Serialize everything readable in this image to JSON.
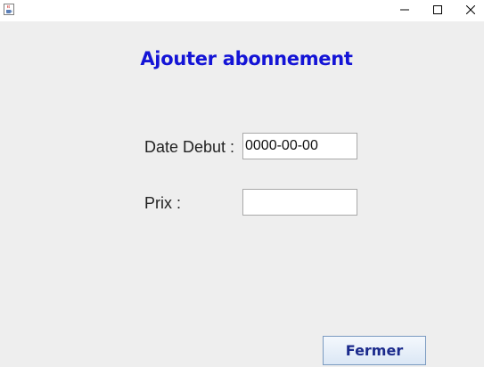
{
  "window": {
    "icon": "java-cup-icon",
    "controls": {
      "minimize": "minimize-icon",
      "maximize": "maximize-icon",
      "close": "close-icon"
    }
  },
  "form": {
    "title": "Ajouter abonnement",
    "title_color": "#1414d6",
    "date_label": "Date Debut :",
    "date_value": "0000-00-00",
    "prix_label": "Prix :",
    "prix_value": ""
  },
  "actions": {
    "close_label": "Fermer"
  }
}
